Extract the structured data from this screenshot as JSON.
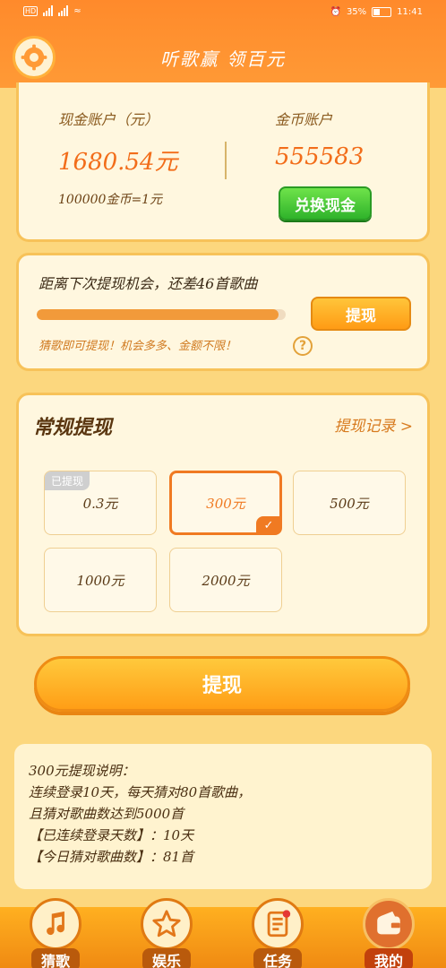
{
  "status_bar": {
    "battery": "35%",
    "time": "11:41"
  },
  "header": {
    "title": "听歌赢 领百元"
  },
  "account": {
    "cash_label": "现金账户（元）",
    "cash_value": "1680.54元",
    "coin_label": "金币账户",
    "coin_value": "555583",
    "rate": "100000金币=1元",
    "exchange_label": "兑换现金"
  },
  "progress": {
    "message": "距离下次提现机会，还差46首歌曲",
    "fraction": 0.97,
    "withdraw_label": "提现",
    "tip": "猜歌即可提现！机会多多、金额不限！",
    "help_icon": "?"
  },
  "regular": {
    "heading": "常规提现",
    "records_label": "提现记录 >",
    "options": [
      {
        "label": "0.3元",
        "badge": "已提现"
      },
      {
        "label": "300元",
        "selected": true
      },
      {
        "label": "500元"
      },
      {
        "label": "1000元"
      },
      {
        "label": "2000元"
      }
    ]
  },
  "main_button": {
    "label": "提现"
  },
  "info": {
    "lines": [
      "300元提现说明：",
      "连续登录10天，每天猜对80首歌曲，",
      "且猜对歌曲数达到5000首",
      "【已连续登录天数】：10天",
      "【今日猜对歌曲数】：81首"
    ]
  },
  "nav": {
    "items": [
      {
        "label": "猜歌",
        "icon": "music-note-icon"
      },
      {
        "label": "娱乐",
        "icon": "star-icon"
      },
      {
        "label": "任务",
        "icon": "task-list-icon"
      },
      {
        "label": "我的",
        "icon": "wallet-icon",
        "active": true
      }
    ]
  },
  "colors": {
    "accent": "#ff9a36",
    "primary_text": "#f26d1a",
    "green": "#2fb32b"
  }
}
